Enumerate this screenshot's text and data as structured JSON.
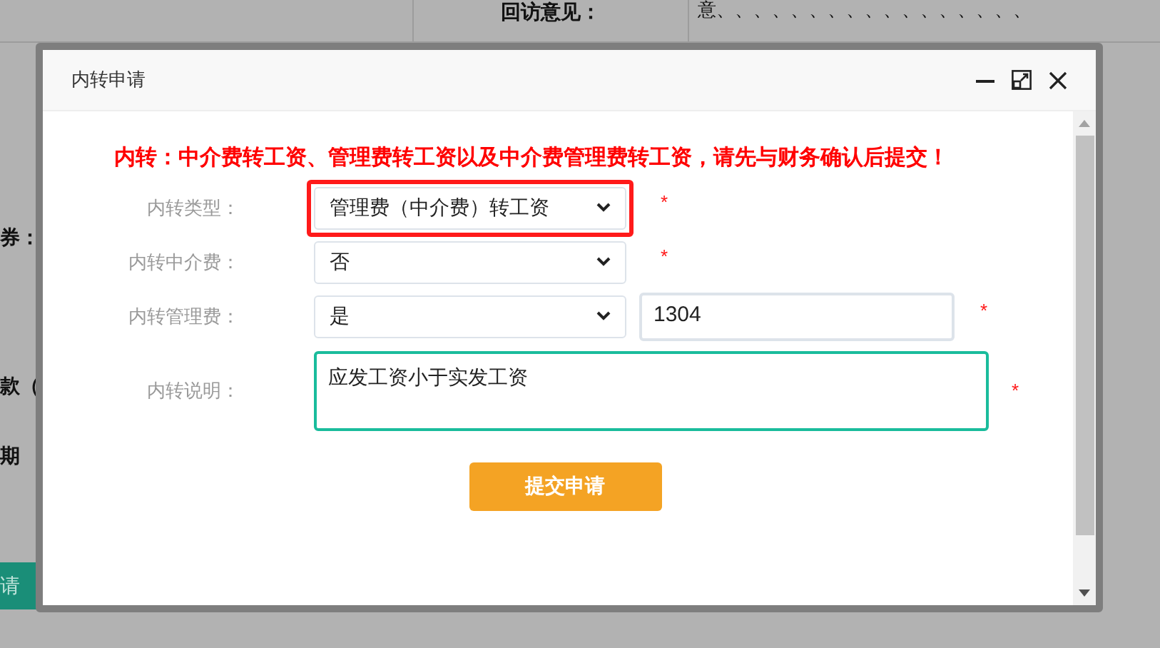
{
  "background": {
    "top_label": "回访意见：",
    "top_value": "意、、、、、、、、、、、、、、、、、",
    "side_labels": [
      "券：",
      "款（",
      "期"
    ],
    "side_button": "请"
  },
  "window": {
    "title": "内转申请"
  },
  "notice": "内转：中介费转工资、管理费转工资以及中介费管理费转工资，请先与财务确认后提交！",
  "fields": [
    {
      "kind": "select",
      "label": "内转类型：",
      "value": "管理费（中介费）转工资",
      "required_mark": "*",
      "highlighted": true
    },
    {
      "kind": "select",
      "label": "内转中介费：",
      "value": "否",
      "required_mark": "*",
      "highlighted": false
    },
    {
      "kind": "select_input",
      "label": "内转管理费：",
      "value": "是",
      "input_value": "1304",
      "required_mark": "*",
      "highlighted": false
    },
    {
      "kind": "textarea",
      "label": "内转说明：",
      "value": "应发工资小于实发工资",
      "required_mark": "*",
      "focused": true
    }
  ],
  "submit": "提交申请"
}
